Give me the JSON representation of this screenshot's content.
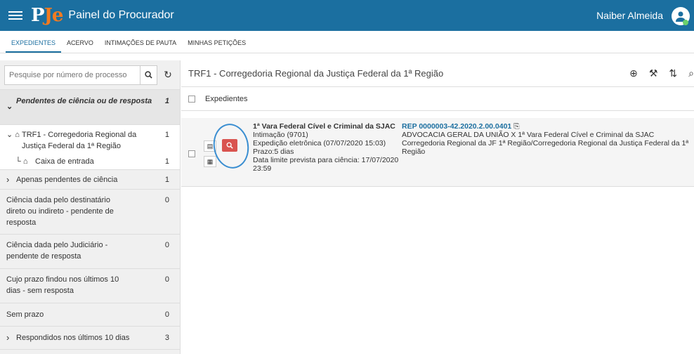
{
  "topbar": {
    "logo_p": "P",
    "logo_je": "Je",
    "title": "Painel do Procurador",
    "user": "Naiber Almeida"
  },
  "tabs": [
    "EXPEDIENTES",
    "ACERVO",
    "INTIMAÇÕES DE PAUTA",
    "MINHAS PETIÇÕES"
  ],
  "search": {
    "placeholder": "Pesquise por número de processo",
    "value": ""
  },
  "sidebar": {
    "group": {
      "label": "Pendentes de ciência ou de resposta",
      "count": "1"
    },
    "org": {
      "label": "TRF1 - Corregedoria Regional da Justiça Federal da 1ª Região",
      "count": "1"
    },
    "inbox": {
      "label": "Caixa de entrada",
      "count": "1"
    },
    "items": [
      {
        "label": "Apenas pendentes de ciência",
        "count": "1"
      },
      {
        "label": "Ciência dada pelo destinatário direto ou indireto - pendente de resposta",
        "count": "0"
      },
      {
        "label": "Ciência dada pelo Judiciário - pendente de resposta",
        "count": "0"
      },
      {
        "label": "Cujo prazo findou nos últimos 10 dias - sem resposta",
        "count": "0"
      },
      {
        "label": "Sem prazo",
        "count": "0"
      },
      {
        "label": "Respondidos nos últimos 10 dias",
        "count": "3"
      }
    ]
  },
  "main": {
    "header": "TRF1 - Corregedoria Regional da Justiça Federal da 1ª Região",
    "exp_header": "Expedientes",
    "row": {
      "orgao": "1ª Vara Federal Cível e Criminal da SJAC",
      "tipo": "Intimação (9701)",
      "expedicao": "Expedição eletrônica (07/07/2020 15:03)",
      "prazo": "Prazo:5 dias",
      "limite": "Data limite prevista para ciência: 17/07/2020 23:59",
      "processo": "REP 0000003-42.2020.2.00.0401",
      "partes": "ADVOCACIA GERAL DA UNIÃO X 1ª Vara Federal Cível e Criminal da SJAC",
      "orgao_julgador": "Corregedoria Regional da JF 1ª Região/Corregedoria Regional da Justiça Federal da 1ª Região"
    }
  }
}
